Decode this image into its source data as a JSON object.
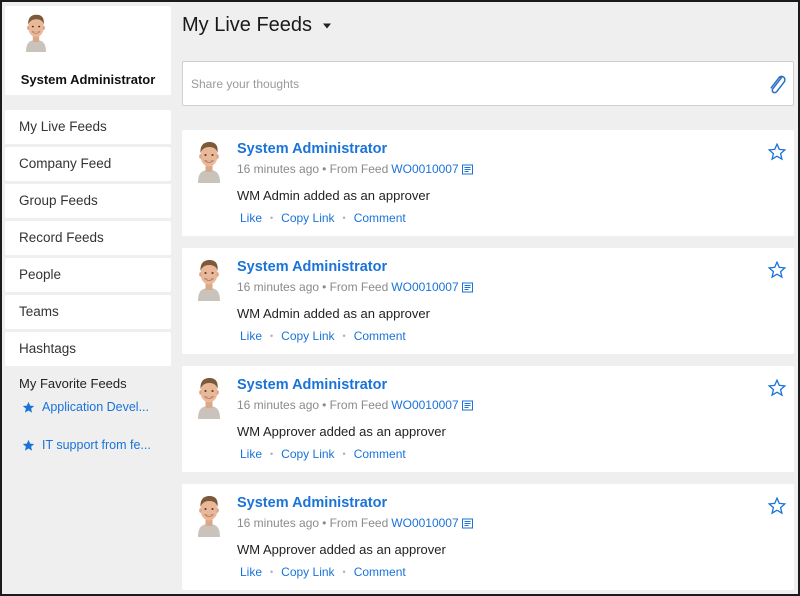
{
  "user": {
    "name": "System Administrator"
  },
  "sidebar": {
    "items": [
      {
        "label": "My Live Feeds"
      },
      {
        "label": "Company Feed"
      },
      {
        "label": "Group Feeds"
      },
      {
        "label": "Record Feeds"
      },
      {
        "label": "People"
      },
      {
        "label": "Teams"
      },
      {
        "label": "Hashtags"
      }
    ],
    "favorites_title": "My Favorite Feeds",
    "favorites": [
      {
        "label": "Application Devel...",
        "icon": "star-filled-icon"
      },
      {
        "label": "IT support from fe...",
        "icon": "star-filled-icon"
      }
    ]
  },
  "header": {
    "title": "My Live Feeds",
    "dropdown_icon": "caret-down-icon"
  },
  "composer": {
    "placeholder": "Share your thoughts",
    "value": "",
    "icon": "paperclip-icon"
  },
  "posts": [
    {
      "author": "System Administrator",
      "time": "16 minutes ago",
      "source": "• From Feed",
      "record": "WO0010007",
      "text": "WM Admin added as an approver",
      "actions": [
        "Like",
        "Copy Link",
        "Comment"
      ]
    },
    {
      "author": "System Administrator",
      "time": "16 minutes ago",
      "source": "• From Feed",
      "record": "WO0010007",
      "text": "WM Admin added as an approver",
      "actions": [
        "Like",
        "Copy Link",
        "Comment"
      ]
    },
    {
      "author": "System Administrator",
      "time": "16 minutes ago",
      "source": "• From Feed",
      "record": "WO0010007",
      "text": "WM Approver added as an approver",
      "actions": [
        "Like",
        "Copy Link",
        "Comment"
      ]
    },
    {
      "author": "System Administrator",
      "time": "16 minutes ago",
      "source": "• From Feed",
      "record": "WO0010007",
      "text": "WM Approver added as an approver",
      "actions": [
        "Like",
        "Copy Link",
        "Comment"
      ]
    }
  ],
  "colors": {
    "accent": "#1a73d9",
    "background": "#efefef",
    "card": "#ffffff"
  }
}
